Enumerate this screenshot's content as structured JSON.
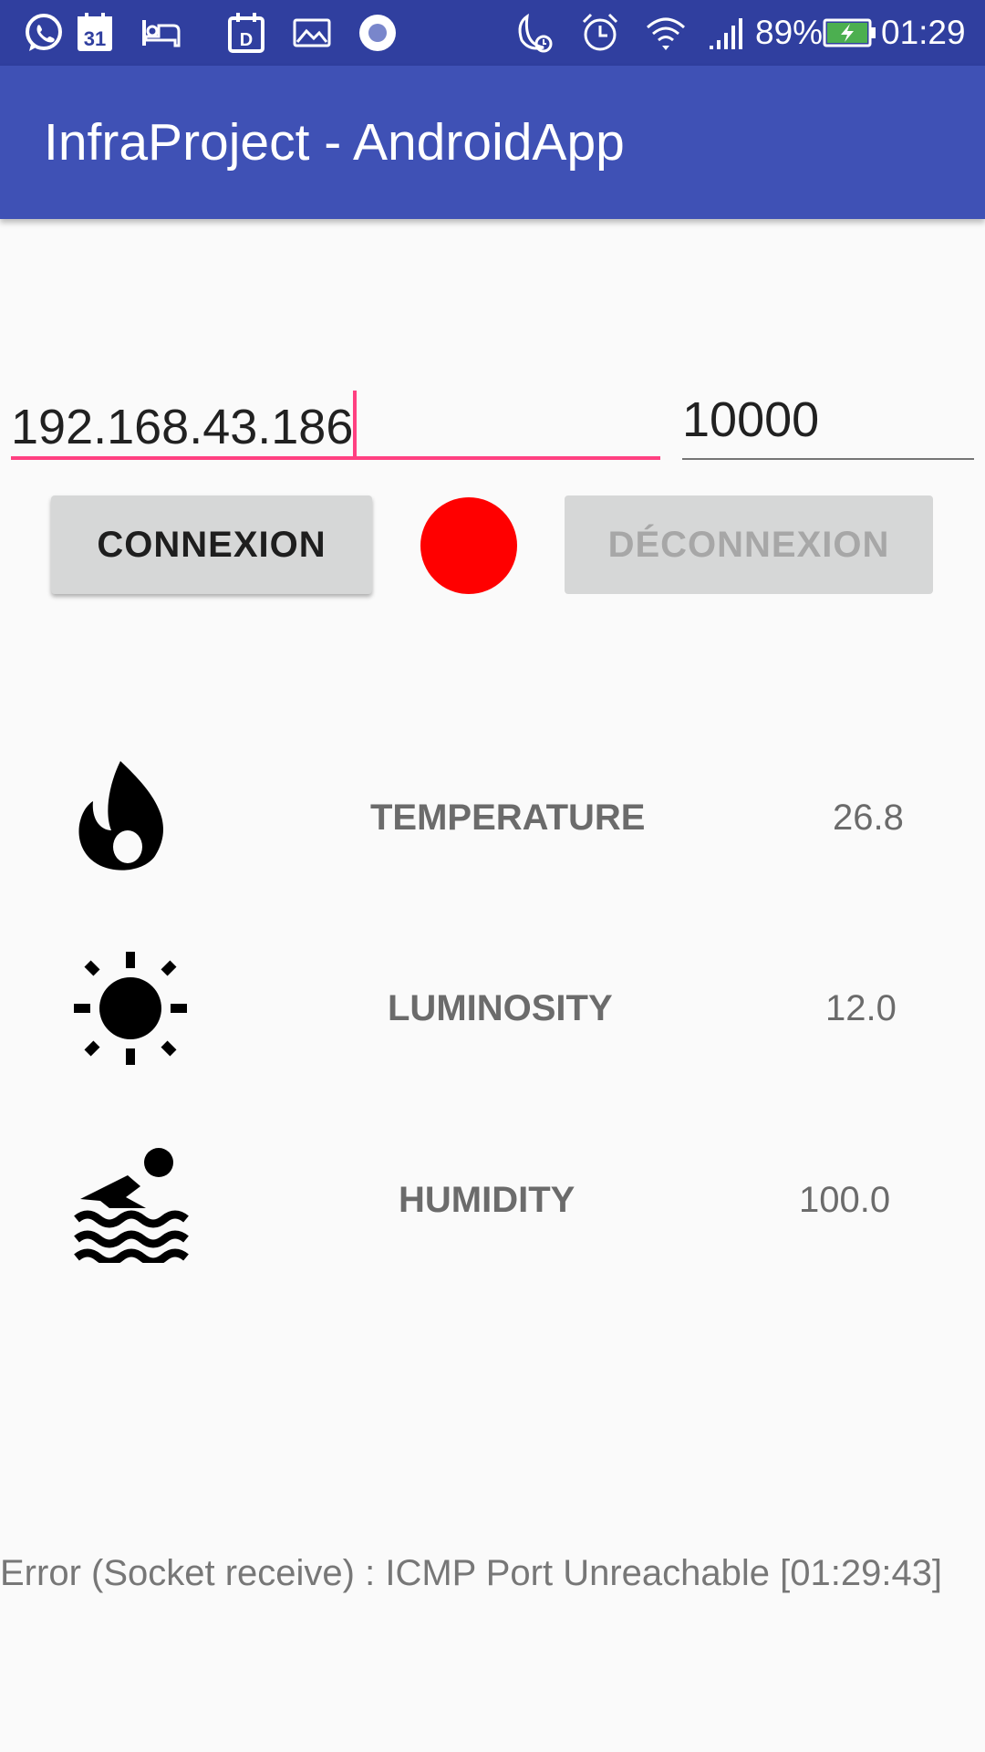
{
  "status_bar": {
    "icons": [
      "whatsapp-icon",
      "calendar-icon",
      "hotel-icon",
      "calendar-d-icon",
      "image-icon",
      "record-icon",
      "moon-alarm-icon",
      "alarm-icon",
      "wifi-icon",
      "signal-icon",
      "battery-charging-icon"
    ],
    "calendar_day": "31",
    "calendar_letter": "D",
    "battery_percent": "89%",
    "time": "01:29"
  },
  "app_bar": {
    "title": "InfraProject - AndroidApp"
  },
  "connection": {
    "ip_value": "192.168.43.186",
    "port_value": "10000",
    "connect_label": "CONNEXION",
    "disconnect_label": "DÉCONNEXION",
    "status_color": "#ff0000"
  },
  "sensors": [
    {
      "icon": "flame-icon",
      "label": "TEMPERATURE",
      "value": "26.8"
    },
    {
      "icon": "sun-icon",
      "label": "LUMINOSITY",
      "value": "12.0"
    },
    {
      "icon": "swimmer-icon",
      "label": "HUMIDITY",
      "value": "100.0"
    }
  ],
  "error_message": "Error (Socket receive) : ICMP Port Unreachable [01:29:43]",
  "colors": {
    "primary_dark": "#303f9f",
    "primary": "#3f51b5",
    "accent": "#ff4081"
  }
}
